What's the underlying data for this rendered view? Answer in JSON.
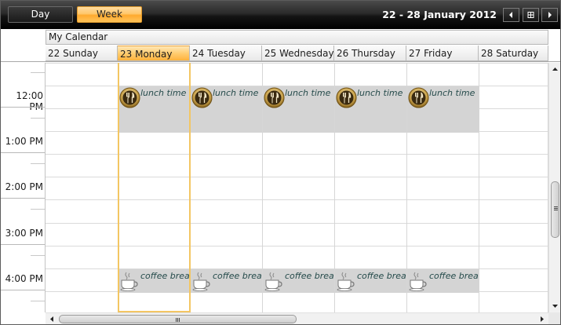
{
  "toolbar": {
    "view_day_label": "Day",
    "view_week_label": "Week",
    "date_range": "22  - 28 January 2012",
    "prev_icon": "triangle-left-icon",
    "today_icon": "calendar-grid-icon",
    "next_icon": "triangle-right-icon"
  },
  "calendar_name": "My Calendar",
  "days": [
    {
      "label": "22 Sunday",
      "selected": false
    },
    {
      "label": "23 Monday",
      "selected": true
    },
    {
      "label": "24 Tuesday",
      "selected": false
    },
    {
      "label": "25 Wednesday",
      "selected": false
    },
    {
      "label": "26 Thursday",
      "selected": false
    },
    {
      "label": "27 Friday",
      "selected": false
    },
    {
      "label": "28 Saturday",
      "selected": false
    }
  ],
  "time_labels": [
    "12:00 PM",
    "1:00 PM",
    "2:00 PM",
    "3:00 PM",
    "4:00 PM"
  ],
  "appointments": {
    "lunch": {
      "subject": "lunch time",
      "icon": "fork-knife-icon",
      "day_indexes": [
        1,
        2,
        3,
        4,
        5
      ]
    },
    "coffee": {
      "subject": "coffee break",
      "icon": "coffee-cup-icon",
      "day_indexes": [
        1,
        2,
        3,
        4,
        5
      ]
    }
  },
  "colors": {
    "selected_accent": "#ffc76b",
    "appointment_bg": "#d4d4d4",
    "toolbar_bg": "#1a1a1a"
  }
}
